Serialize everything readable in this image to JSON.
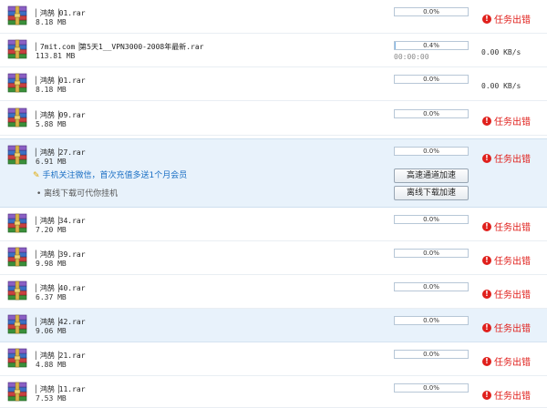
{
  "colors": {
    "error_red": "#e0201c",
    "highlight_row": "#e8f2fb",
    "progress_fill": "#7fb5e6",
    "promo_link": "#1a6fc4"
  },
  "icons": {
    "file": "rar-archive-icon",
    "error": "exclamation-circle-icon",
    "promo": "lightbulb-icon"
  },
  "tasks": [
    {
      "name": "▏鸿鹄▕01.rar",
      "size": "8.18 MB",
      "progress_pct": 0.0,
      "progress_text": "0.0%",
      "status": "任务出错"
    },
    {
      "name": "▏7mit.com▕第5天1__VPN3000-2008年最新.rar",
      "size": "113.81 MB",
      "progress_pct": 0.4,
      "progress_text": "0.4%",
      "time": "00:00:00",
      "speed": "0.00  KB/s"
    },
    {
      "name": "▏鸿鹄▕01.rar",
      "size": "8.18 MB",
      "progress_pct": 0.0,
      "progress_text": "0.0%",
      "speed": "0.00  KB/s"
    },
    {
      "name": "▏鸿鹄▕09.rar",
      "size": "5.88 MB",
      "progress_pct": 0.0,
      "progress_text": "0.0%",
      "status": "任务出错"
    },
    {
      "name": "▏鸿鹄▕27.rar",
      "size": "6.91 MB",
      "progress_pct": 0.0,
      "progress_text": "0.0%",
      "status": "任务出错",
      "promo": "手机关注微信，首次充值多送1个月会员",
      "offline_tip": "• 离线下载可代你挂机",
      "high_speed_button": "高速通道加速",
      "offline_button": "离线下载加速"
    },
    {
      "name": "▏鸿鹄▕34.rar",
      "size": "7.20 MB",
      "progress_pct": 0.0,
      "progress_text": "0.0%",
      "status": "任务出错"
    },
    {
      "name": "▏鸿鹄▕39.rar",
      "size": "9.98 MB",
      "progress_pct": 0.0,
      "progress_text": "0.0%",
      "status": "任务出错"
    },
    {
      "name": "▏鸿鹄▕40.rar",
      "size": "6.37 MB",
      "progress_pct": 0.0,
      "progress_text": "0.0%",
      "status": "任务出错"
    },
    {
      "name": "▏鸿鹄▕42.rar",
      "size": "9.06 MB",
      "progress_pct": 0.0,
      "progress_text": "0.0%",
      "status": "任务出错"
    },
    {
      "name": "▏鸿鹄▕21.rar",
      "size": "4.88 MB",
      "progress_pct": 0.0,
      "progress_text": "0.0%",
      "status": "任务出错"
    },
    {
      "name": "▏鸿鹄▕11.rar",
      "size": "7.53 MB",
      "progress_pct": 0.0,
      "progress_text": "0.0%",
      "status": "任务出错"
    }
  ]
}
